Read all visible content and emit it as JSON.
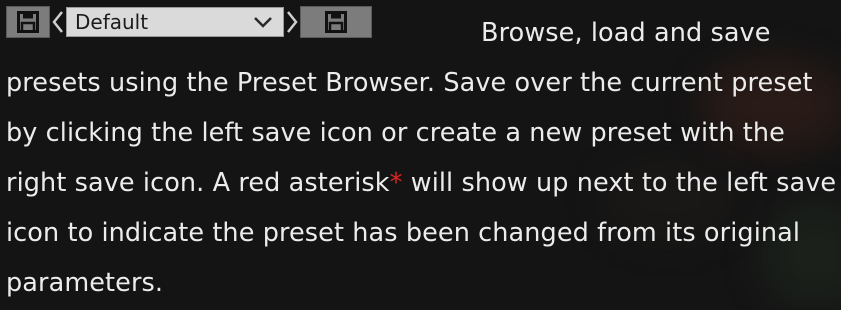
{
  "preset_browser": {
    "selected_preset": "Default"
  },
  "description": {
    "part1": "Browse, load and save presets using the Preset Browser. Save over the current preset by clicking the left save icon or create a new preset with the right save icon. A red asterisk",
    "asterisk": "*",
    "part2": " will show up next to the left save icon to indicate the preset has been changed from its original parameters."
  },
  "icons": {
    "left_save": "floppy-disk-icon",
    "prev": "chevron-left-icon",
    "dropdown": "chevron-down-icon",
    "next": "chevron-right-icon",
    "right_save": "floppy-disk-icon"
  },
  "colors": {
    "background": "#141414",
    "text": "#ececec",
    "asterisk": "#e0261f",
    "button": "#7c7c7c",
    "select": "#dadada"
  }
}
